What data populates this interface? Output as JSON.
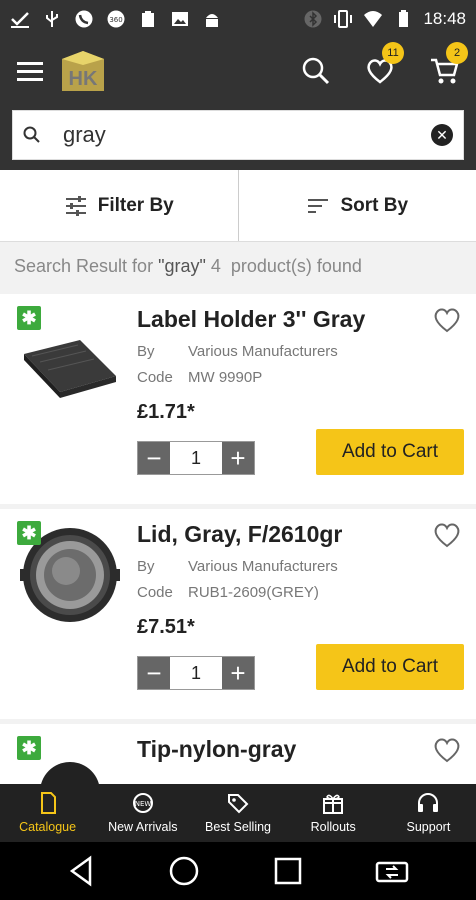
{
  "status_bar": {
    "time": "18:48"
  },
  "app_bar": {
    "logo_text": "HK",
    "wishlist_count": "11",
    "cart_count": "2"
  },
  "search": {
    "value": "gray"
  },
  "filter_bar": {
    "filter_label": "Filter By",
    "sort_label": "Sort By"
  },
  "result_info": {
    "prefix": "Search Result for ",
    "query": "\"gray\"",
    "suffix": " 4  product(s) found"
  },
  "products": [
    {
      "title": "Label Holder 3'' Gray",
      "by_label": "By",
      "manufacturer": "Various Manufacturers",
      "code_label": "Code",
      "code": "MW  9990P",
      "price": "£1.71*",
      "qty": "1",
      "add_label": "Add to Cart"
    },
    {
      "title": "Lid, Gray, F/2610gr",
      "by_label": "By",
      "manufacturer": "Various Manufacturers",
      "code_label": "Code",
      "code": "RUB1-2609(GREY)",
      "price": "£7.51*",
      "qty": "1",
      "add_label": "Add to Cart"
    },
    {
      "title": "Tip-nylon-gray"
    }
  ],
  "bottom_nav": {
    "items": [
      {
        "label": "Catalogue",
        "icon": "catalogue-icon",
        "active": true
      },
      {
        "label": "New Arrivals",
        "icon": "new-icon",
        "active": false
      },
      {
        "label": "Best Selling",
        "icon": "tag-icon",
        "active": false
      },
      {
        "label": "Rollouts",
        "icon": "gift-icon",
        "active": false
      },
      {
        "label": "Support",
        "icon": "headset-icon",
        "active": false
      }
    ]
  },
  "colors": {
    "accent": "#f5c518",
    "bar": "#333333",
    "new_badge": "#3daa3d"
  }
}
